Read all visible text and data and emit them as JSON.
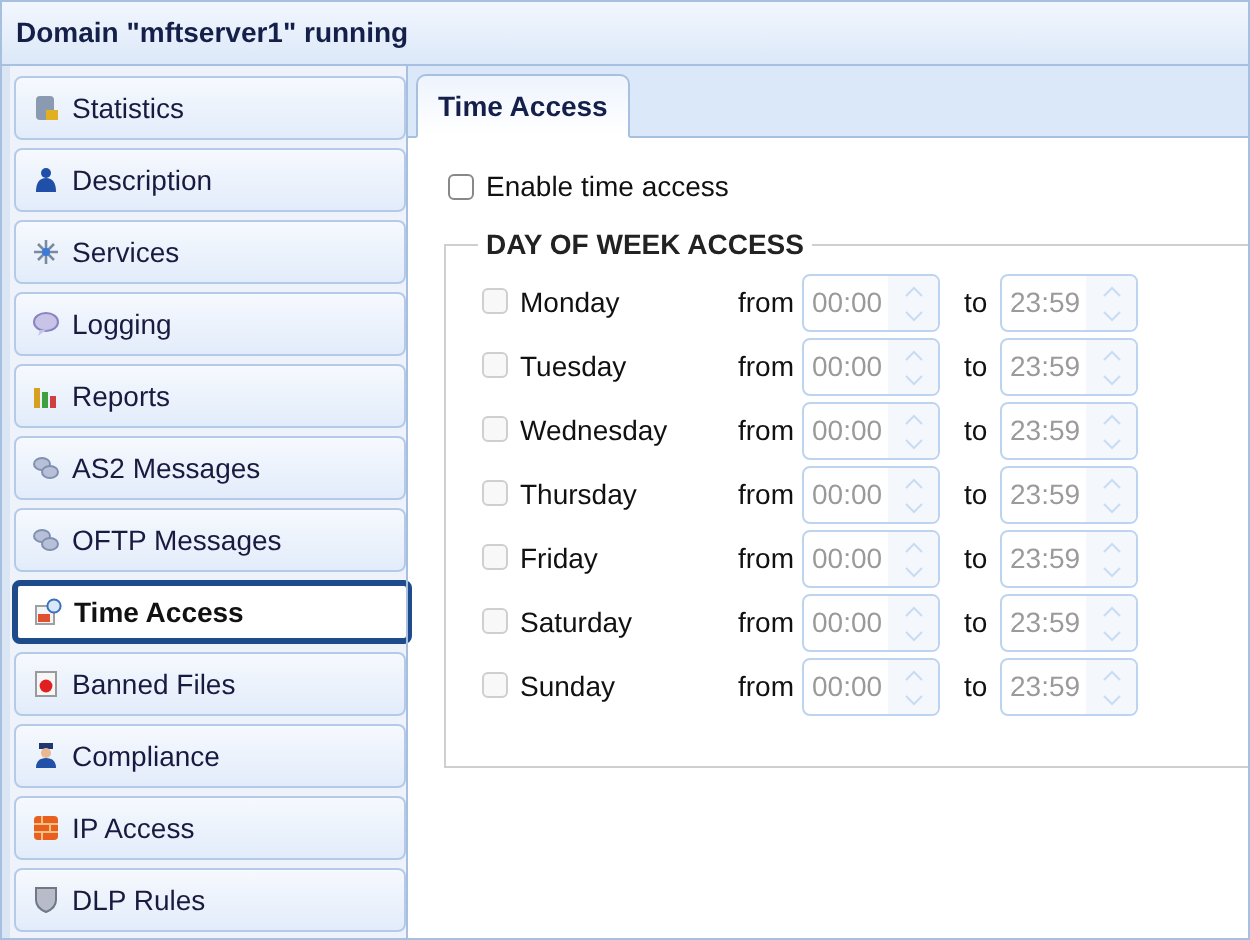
{
  "window": {
    "title": "Domain \"mftserver1\" running"
  },
  "sidebar": {
    "items": [
      {
        "label": "Statistics",
        "selected": false
      },
      {
        "label": "Description",
        "selected": false
      },
      {
        "label": "Services",
        "selected": false
      },
      {
        "label": "Logging",
        "selected": false
      },
      {
        "label": "Reports",
        "selected": false
      },
      {
        "label": "AS2 Messages",
        "selected": false
      },
      {
        "label": "OFTP Messages",
        "selected": false
      },
      {
        "label": "Time Access",
        "selected": true
      },
      {
        "label": "Banned Files",
        "selected": false
      },
      {
        "label": "Compliance",
        "selected": false
      },
      {
        "label": "IP Access",
        "selected": false
      },
      {
        "label": "DLP Rules",
        "selected": false
      }
    ]
  },
  "tabs": [
    {
      "label": "Time Access",
      "selected": true
    }
  ],
  "enable": {
    "label": "Enable time access",
    "checked": false
  },
  "section": {
    "title": "DAY OF WEEK ACCESS",
    "days": [
      {
        "day": "Monday",
        "checked": false,
        "disabled": true,
        "from_label": "from",
        "from": "00:00",
        "to_label": "to",
        "to": "23:59"
      },
      {
        "day": "Tuesday",
        "checked": false,
        "disabled": true,
        "from_label": "from",
        "from": "00:00",
        "to_label": "to",
        "to": "23:59"
      },
      {
        "day": "Wednesday",
        "checked": false,
        "disabled": true,
        "from_label": "from",
        "from": "00:00",
        "to_label": "to",
        "to": "23:59"
      },
      {
        "day": "Thursday",
        "checked": false,
        "disabled": true,
        "from_label": "from",
        "from": "00:00",
        "to_label": "to",
        "to": "23:59"
      },
      {
        "day": "Friday",
        "checked": false,
        "disabled": true,
        "from_label": "from",
        "from": "00:00",
        "to_label": "to",
        "to": "23:59"
      },
      {
        "day": "Saturday",
        "checked": false,
        "disabled": true,
        "from_label": "from",
        "from": "00:00",
        "to_label": "to",
        "to": "23:59"
      },
      {
        "day": "Sunday",
        "checked": false,
        "disabled": true,
        "from_label": "from",
        "from": "00:00",
        "to_label": "to",
        "to": "23:59"
      }
    ]
  }
}
